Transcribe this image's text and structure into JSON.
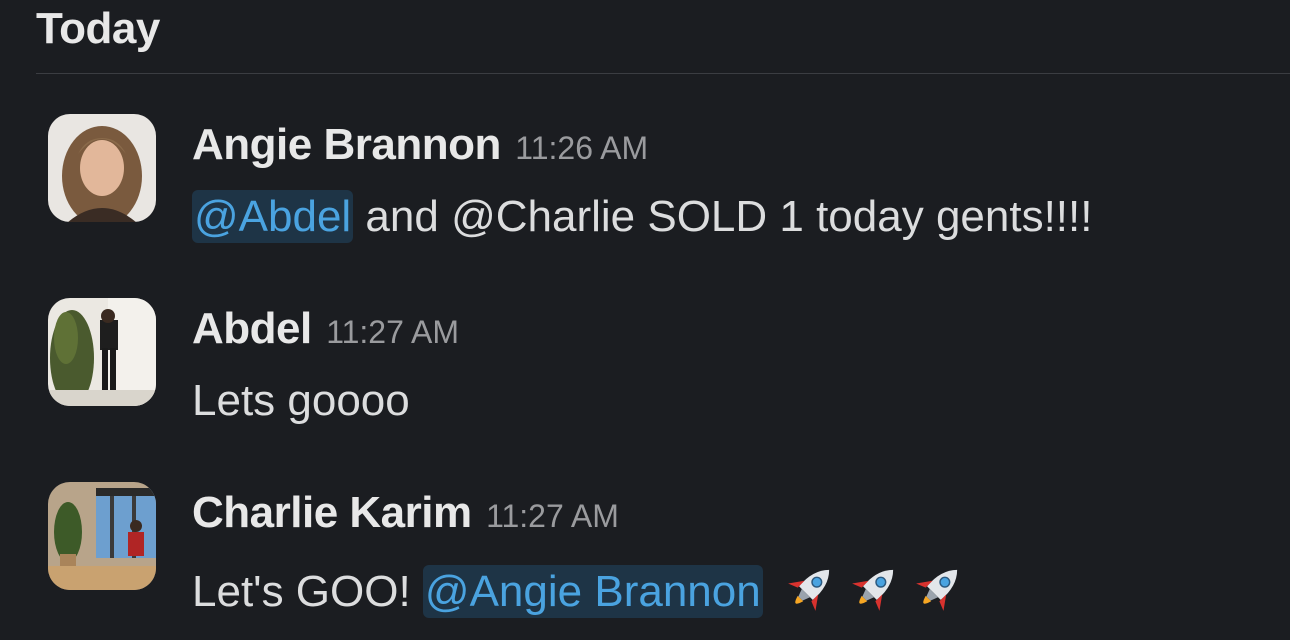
{
  "day_divider": {
    "label": "Today"
  },
  "messages": [
    {
      "author": "Angie Brannon",
      "time": "11:26 AM",
      "body": {
        "mention": "@Abdel",
        "text": " and @Charlie SOLD 1 today gents!!!!"
      }
    },
    {
      "author": "Abdel",
      "time": "11:27 AM",
      "body": {
        "text": "Lets goooo"
      }
    },
    {
      "author": "Charlie Karim",
      "time": "11:27 AM",
      "body": {
        "text": "Let's GOO! ",
        "mention": "@Angie Brannon",
        "emojis": [
          "rocket",
          "rocket",
          "rocket"
        ]
      }
    }
  ],
  "colors": {
    "background": "#1b1d21",
    "mention_text": "#4aa3e0",
    "mention_bg": "#1e3446",
    "timestamp": "#9a9b9e"
  }
}
